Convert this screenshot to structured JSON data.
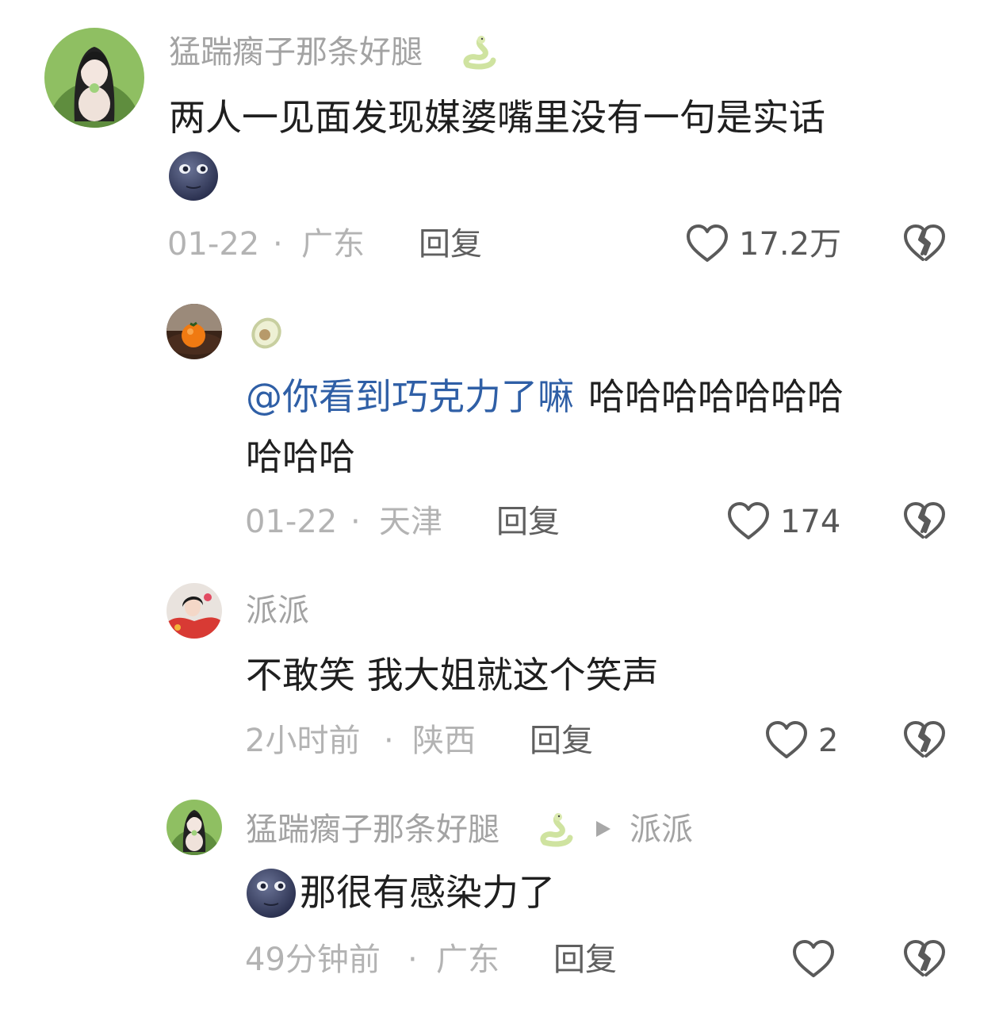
{
  "comments": [
    {
      "user": "猛踹瘸子那条好腿",
      "user_badge_icon": "snake-emoji",
      "text": "两人一见面发现媒婆嘴里没有一句是实话",
      "text_emoji": "new-moon-face-emoji",
      "time": "01-22",
      "sep": "·",
      "location": "广东",
      "reply_label": "回复",
      "likes": "17.2万"
    },
    {
      "user_icon": "avocado-emoji",
      "mention": "@你看到巧克力了嘛",
      "text_line1": "哈哈哈哈哈哈哈",
      "text_line2": "哈哈哈",
      "time": "01-22",
      "sep": "·",
      "location": "天津",
      "reply_label": "回复",
      "likes": "174"
    },
    {
      "user": "派派",
      "text": "不敢笑 我大姐就这个笑声",
      "time": "2小时前",
      "sep": "·",
      "location": "陕西",
      "reply_label": "回复",
      "likes": "2"
    },
    {
      "user": "猛踹瘸子那条好腿",
      "user_badge_icon": "snake-emoji",
      "reply_to_arrow_icon": "play-triangle-icon",
      "reply_to": "派派",
      "text_emoji": "new-moon-face-emoji",
      "text": "那很有感染力了",
      "time": "49分钟前",
      "sep": "·",
      "location": "广东",
      "reply_label": "回复",
      "likes": ""
    }
  ],
  "icons": {
    "like": "heart-outline-icon",
    "dislike": "broken-heart-icon"
  },
  "colors": {
    "username": "#a3a3a3",
    "text": "#1f1f1f",
    "meta": "#b3b3b3",
    "mention": "#2f5fa6",
    "icon": "#5a5a5a"
  }
}
